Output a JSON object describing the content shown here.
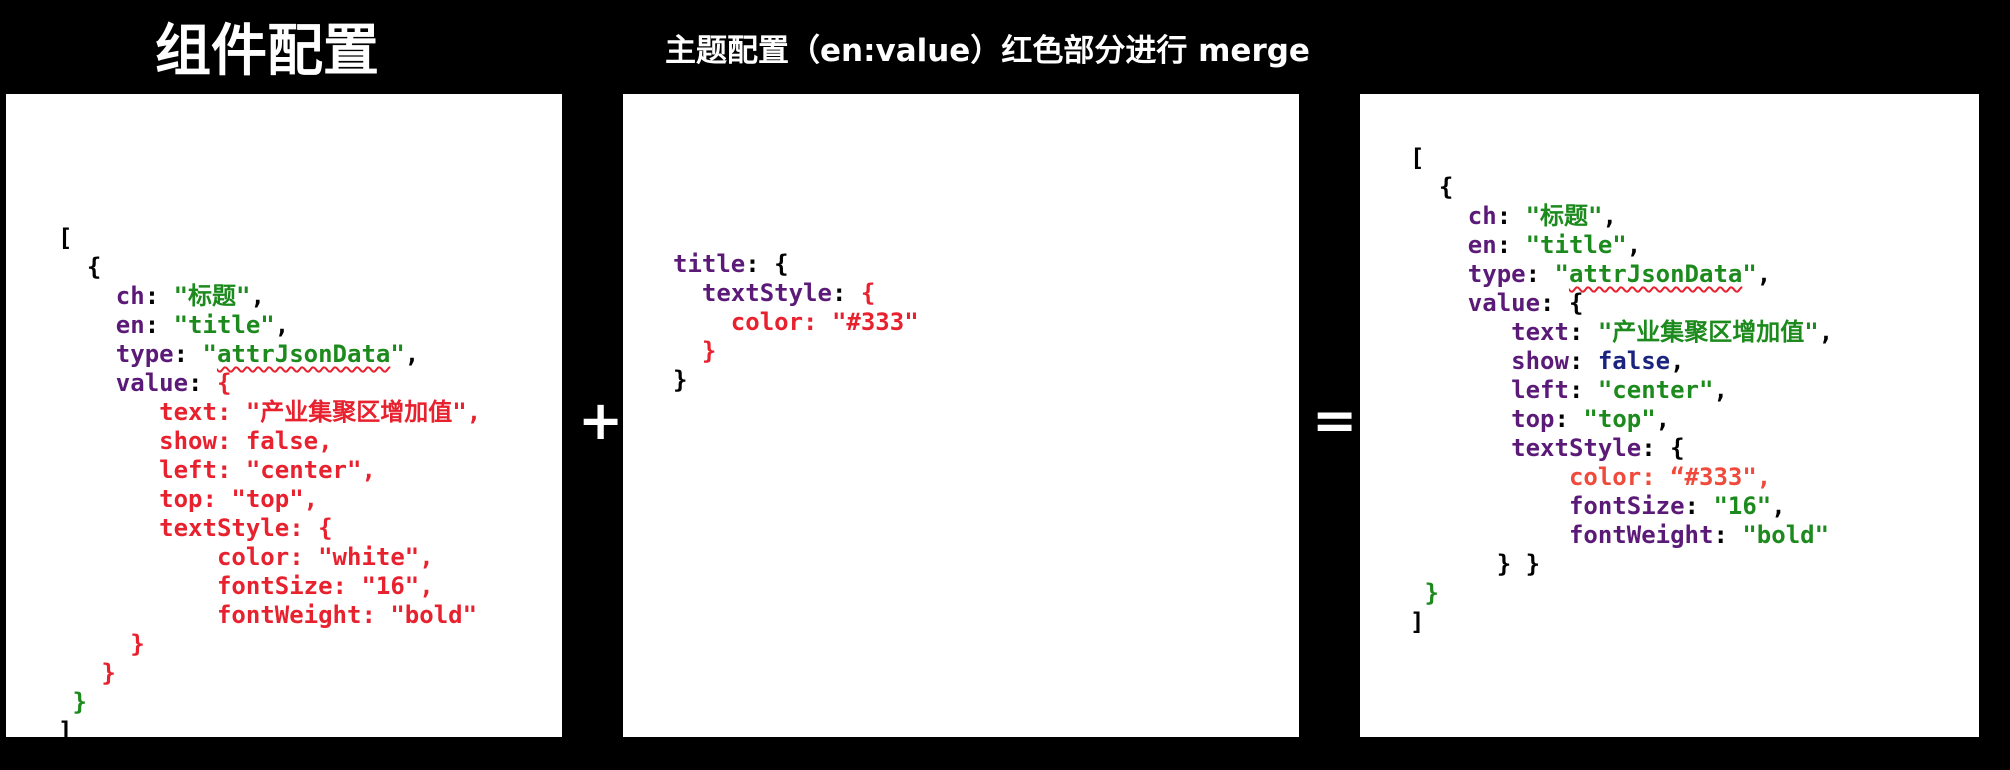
{
  "headings": {
    "component_config": "组件配置",
    "theme_config": "主题配置（en:value）红色部分进行 merge"
  },
  "operators": {
    "plus": "+",
    "equals": "="
  },
  "colors": {
    "background": "#000000",
    "panel": "#ffffff",
    "key": "#5b1a78",
    "string": "#1d8a1d",
    "boolean": "#1a237e",
    "highlight_red": "#e8212f"
  },
  "component_code": {
    "open_bracket": "[",
    "open_brace": "{",
    "ch_key": "ch",
    "ch_value": "\"标题\"",
    "en_key": "en",
    "en_value": "\"title\"",
    "type_key": "type",
    "type_q1": "\"",
    "type_value": "attrJsonData",
    "type_q2": "\"",
    "value_key": "value",
    "value_open": "{",
    "text_line": "text: \"产业集聚区增加值\",",
    "show_line": "show: false,",
    "left_line": "left: \"center\",",
    "top_line": "top: \"top\",",
    "textstyle_key": "textStyle:",
    "textstyle_open": "{",
    "color_line": "color: \"white\",",
    "fontsize_line": "fontSize: \"16\",",
    "fontweight_line": "fontWeight: \"bold\"",
    "textstyle_close": "}",
    "value_close": "}",
    "item_close": "}",
    "close_bracket": "]"
  },
  "theme_code": {
    "title_key": "title",
    "title_open": "{",
    "textstyle_key": "textStyle",
    "textstyle_open": "{",
    "color_line": "color: \"#333\"",
    "textstyle_close": "}",
    "title_close": "}"
  },
  "merged_code": {
    "open_bracket": "[",
    "open_brace": "{",
    "ch_key": "ch",
    "ch_value": "\"标题\"",
    "en_key": "en",
    "en_value": "\"title\"",
    "type_key": "type",
    "type_q1": "\"",
    "type_value": "attrJsonData",
    "type_q2": "\"",
    "value_key": "value",
    "value_open": "{",
    "text_key": "text",
    "text_value": "\"产业集聚区增加值\"",
    "show_key": "show",
    "show_value": "false",
    "left_key": "left",
    "left_value": "\"center\"",
    "top_key": "top",
    "top_value": "\"top\"",
    "textstyle_key": "textStyle",
    "textstyle_open": "{",
    "color_line": "color: “#333\",",
    "fontsize_key": "fontSize",
    "fontsize_value": "\"16\"",
    "fontweight_key": "fontWeight",
    "fontweight_value": "\"bold\"",
    "inner_close": "} }",
    "item_close": "}",
    "close_bracket": "]"
  }
}
